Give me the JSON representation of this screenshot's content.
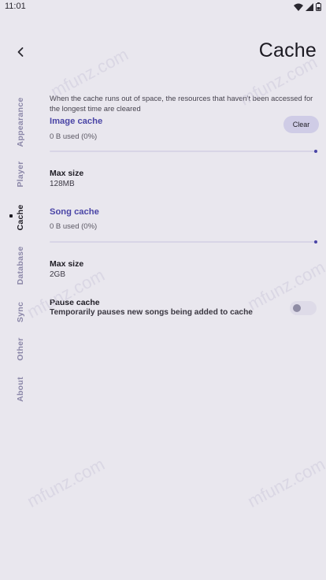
{
  "status_bar": {
    "time": "11:01",
    "icons": [
      "wifi-icon",
      "signal-icon",
      "battery-icon"
    ]
  },
  "header": {
    "back_icon": "chevron-left-icon",
    "title": "Cache"
  },
  "nav_rail": {
    "items": [
      {
        "label": "Appearance",
        "active": false
      },
      {
        "label": "Player",
        "active": false
      },
      {
        "label": "Cache",
        "active": true
      },
      {
        "label": "Database",
        "active": false
      },
      {
        "label": "Sync",
        "active": false
      },
      {
        "label": "Other",
        "active": false
      },
      {
        "label": "About",
        "active": false
      }
    ]
  },
  "content": {
    "description": "When the cache runs out of space, the resources that haven't been accessed for the longest time are cleared",
    "image_cache": {
      "title": "Image cache",
      "used": "0 B used (0%)",
      "usage_fraction": 0,
      "clear_label": "Clear",
      "max_size_label": "Max size",
      "max_size_value": "128MB"
    },
    "song_cache": {
      "title": "Song cache",
      "used": "0 B used (0%)",
      "usage_fraction": 0,
      "max_size_label": "Max size",
      "max_size_value": "2GB"
    },
    "pause_cache": {
      "label": "Pause cache",
      "description": "Temporarily pauses new songs being added to cache",
      "enabled": false
    }
  },
  "watermark": "mfunz.com",
  "colors": {
    "background": "#e9e7ee",
    "accent": "#4a45a6",
    "rail_inactive": "#8b87a8",
    "button_bg": "#cfcce6"
  }
}
